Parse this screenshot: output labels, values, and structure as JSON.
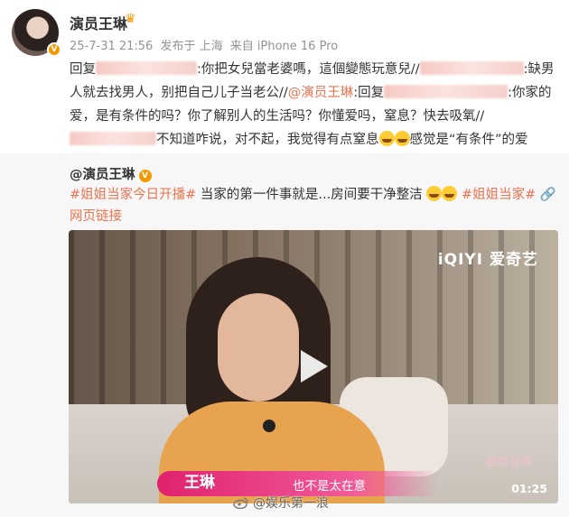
{
  "author": {
    "name": "演员王琳",
    "verified_badge": "V"
  },
  "meta": {
    "date": "25-7-31 21:56",
    "location": "发布于 上海",
    "device": "来自 iPhone 16 Pro"
  },
  "post": {
    "reply_label": "回复",
    "part1": ":你把女兒當老婆嗎，這個變態玩意兒//",
    "part2": ":缺男人就去找男人，别把自己儿子当老公//",
    "mention_self": "@演员王琳",
    "part3": ":回复",
    "part4": ":你家的爱，是有条件的吗？你了解别人的生活吗？你懂爱吗，窒息？快去吸氧//",
    "part5": "不知道咋说，对不起，我觉得有点窒息",
    "part6": "感觉是“有条件”的爱"
  },
  "repost": {
    "author": "@演员王琳",
    "topic1": "#姐姐当家今日开播#",
    "text1": " 当家的第一件事就是...房间要干净整洁",
    "topic2": "#姐姐当家#",
    "link_label": "网页链接",
    "link_icon": "link-icon"
  },
  "video": {
    "brand": "iQIYI 爱奇艺",
    "caption_name": "王琳",
    "caption_line": "也不是太在意",
    "show_logo": "姐姐当家",
    "duration": "01:25"
  },
  "watermark": {
    "text": "@娱乐第一浪"
  },
  "colors": {
    "accent": "#eb7350",
    "badge": "#f39800",
    "meta": "#939393"
  }
}
